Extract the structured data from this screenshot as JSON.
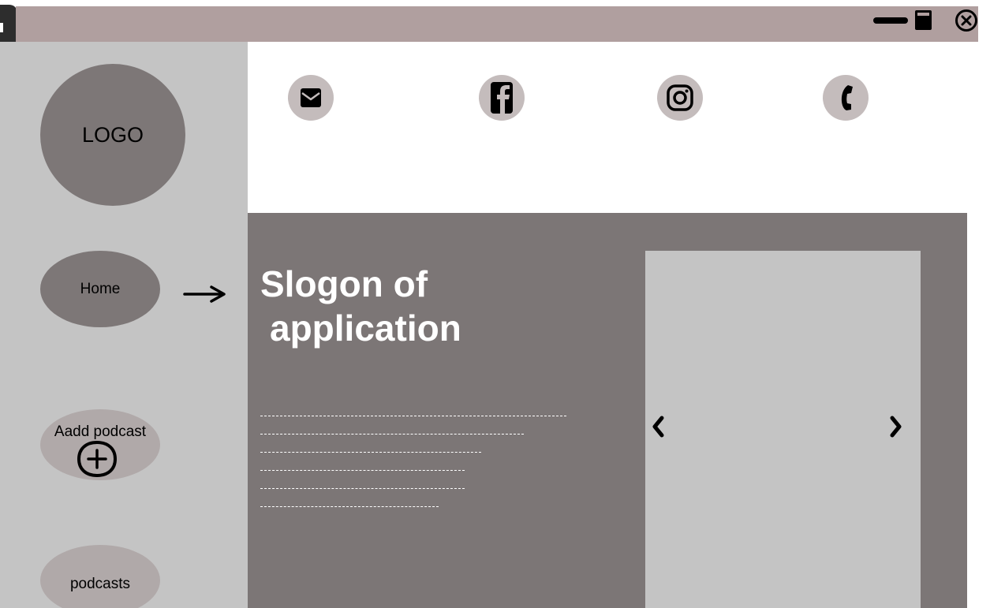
{
  "window": {
    "minimize_icon": "minimize-icon",
    "maximize_icon": "maximize-icon",
    "close_icon": "close-circle-icon"
  },
  "sidebar": {
    "logo_text": "LOGO",
    "items": [
      {
        "label": "Home"
      },
      {
        "label": "Aadd podcast",
        "icon": "plus-circle-icon"
      },
      {
        "label": "podcasts"
      }
    ],
    "arrow_icon": "arrow-right-icon"
  },
  "contact": {
    "icons": [
      "email-icon",
      "facebook-icon",
      "instagram-icon",
      "phone-icon"
    ]
  },
  "hero": {
    "slogan_line1": "Slogon of",
    "slogan_line2": "application",
    "placeholder_lines": 6,
    "carousel": {
      "prev_icon": "chevron-left-icon",
      "next_icon": "chevron-right-icon"
    }
  },
  "colors": {
    "titlebar": "#b09f9f",
    "sidebar": "#c4c4c4",
    "dark_oval": "#7d7777",
    "light_oval": "#b0a9a9",
    "hero": "#7c7676",
    "contact_circle": "#c4bcbc",
    "carousel": "#c4c4c4"
  }
}
